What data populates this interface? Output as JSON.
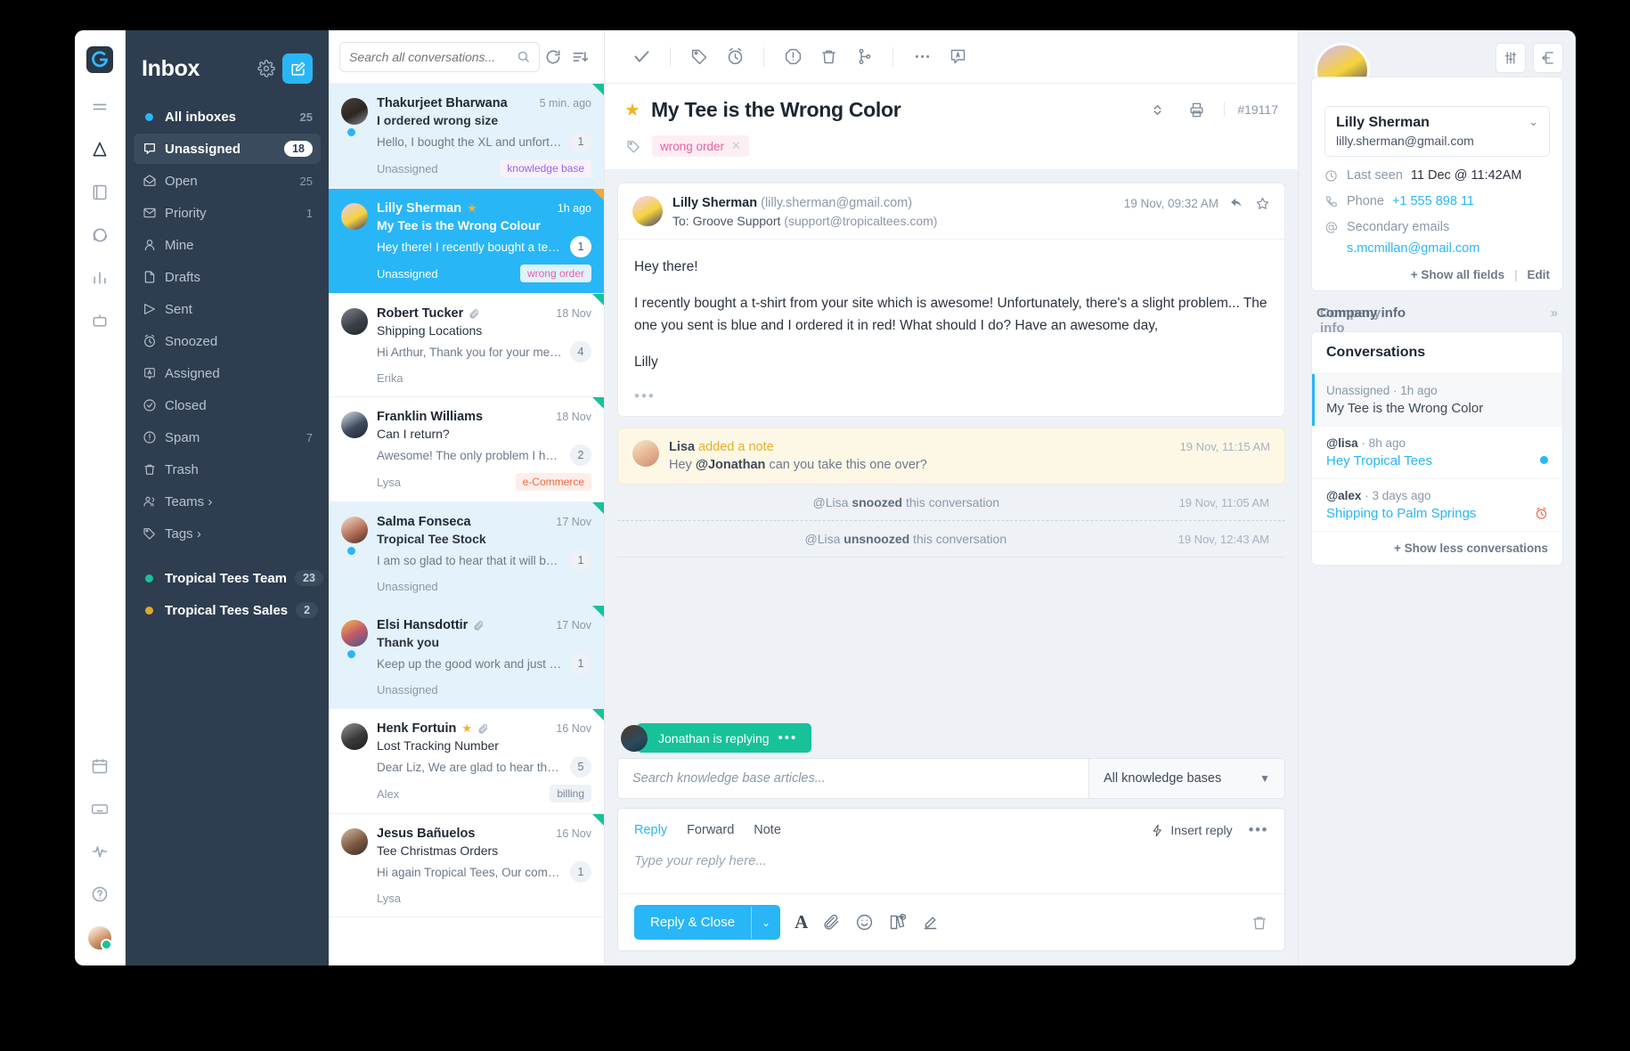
{
  "rail": {
    "logo": "groove-logo",
    "icons": [
      "menu-icon",
      "inbox-icon",
      "contacts-icon",
      "chat-icon",
      "reports-icon",
      "automation-icon",
      "calendar-icon",
      "keyboard-icon",
      "activity-icon",
      "help-icon"
    ]
  },
  "sidebar": {
    "title": "Inbox",
    "gear": "gear-icon",
    "compose": "compose-icon",
    "items": [
      {
        "label": "All inboxes",
        "count": "25",
        "icon": "dot-blue",
        "style": "bold"
      },
      {
        "label": "Unassigned",
        "count": "18",
        "icon": "unassigned-icon",
        "style": "active"
      },
      {
        "label": "Open",
        "count": "25",
        "icon": "open-icon",
        "style": ""
      },
      {
        "label": "Priority",
        "count": "1",
        "icon": "priority-icon",
        "style": ""
      },
      {
        "label": "Mine",
        "count": "",
        "icon": "person-icon",
        "style": ""
      },
      {
        "label": "Drafts",
        "count": "",
        "icon": "draft-icon",
        "style": ""
      },
      {
        "label": "Sent",
        "count": "",
        "icon": "sent-icon",
        "style": ""
      },
      {
        "label": "Snoozed",
        "count": "",
        "icon": "snooze-icon",
        "style": ""
      },
      {
        "label": "Assigned",
        "count": "",
        "icon": "assigned-icon",
        "style": ""
      },
      {
        "label": "Closed",
        "count": "",
        "icon": "closed-icon",
        "style": ""
      },
      {
        "label": "Spam",
        "count": "7",
        "icon": "spam-icon",
        "style": ""
      },
      {
        "label": "Trash",
        "count": "",
        "icon": "trash-icon",
        "style": ""
      },
      {
        "label": "Teams ›",
        "count": "",
        "icon": "teams-icon",
        "style": ""
      },
      {
        "label": "Tags ›",
        "count": "",
        "icon": "tag-icon",
        "style": ""
      }
    ],
    "groups": [
      {
        "label": "Tropical Tees Team",
        "count": "23",
        "dot": "teal"
      },
      {
        "label": "Tropical Tees Sales",
        "count": "2",
        "dot": "amber"
      }
    ]
  },
  "conversation_list": {
    "search_placeholder": "Search all conversations...",
    "search_value": "",
    "refresh_icon": "refresh-icon",
    "sort_icon": "sort-icon",
    "items": [
      {
        "name": "Thakurjeet Bharwana",
        "subject": "I ordered wrong size",
        "preview": "Hello, I bought the XL and unfortuna...",
        "time": "5 min. ago",
        "assignee": "Unassigned",
        "tag": "knowledge base",
        "tag_style": "purple",
        "count": "1",
        "state": "unread",
        "corner": "teal",
        "starred": false,
        "attachment": false,
        "unread_dot": true
      },
      {
        "name": "Lilly Sherman",
        "subject": "My Tee is the Wrong Colour",
        "preview": "Hey there! I recently bought a tee-sh...",
        "time": "1h ago",
        "assignee": "Unassigned",
        "tag": "wrong order",
        "tag_style": "pink",
        "count": "1",
        "state": "selected",
        "corner": "amber",
        "starred": true,
        "attachment": false,
        "unread_dot": false
      },
      {
        "name": "Robert Tucker",
        "subject": "Shipping Locations",
        "preview": "Hi Arthur, Thank you for your messa...",
        "time": "18 Nov",
        "assignee": "Erika",
        "tag": "",
        "tag_style": "",
        "count": "4",
        "state": "",
        "corner": "teal",
        "starred": false,
        "attachment": true,
        "unread_dot": false
      },
      {
        "name": "Franklin Williams",
        "subject": "Can I return?",
        "preview": "Awesome! The only problem I have i...",
        "time": "18 Nov",
        "assignee": "Lysa",
        "tag": "e-Commerce",
        "tag_style": "red",
        "count": "2",
        "state": "",
        "corner": "teal",
        "starred": false,
        "attachment": false,
        "unread_dot": false
      },
      {
        "name": "Salma Fonseca",
        "subject": "Tropical Tee Stock",
        "preview": "I am so glad to hear that it will be ba...",
        "time": "17 Nov",
        "assignee": "Unassigned",
        "tag": "",
        "tag_style": "",
        "count": "1",
        "state": "unread",
        "corner": "teal",
        "starred": false,
        "attachment": false,
        "unread_dot": true
      },
      {
        "name": "Elsi Hansdottir",
        "subject": "Thank you",
        "preview": "Keep up the good work and just let...",
        "time": "17 Nov",
        "assignee": "Unassigned",
        "tag": "",
        "tag_style": "",
        "count": "1",
        "state": "unread",
        "corner": "teal",
        "starred": false,
        "attachment": true,
        "unread_dot": true
      },
      {
        "name": "Henk Fortuin",
        "subject": "Lost Tracking Number",
        "preview": "Dear Liz, We are glad to hear that yo...",
        "time": "16 Nov",
        "assignee": "Alex",
        "tag": "billing",
        "tag_style": "gray",
        "count": "5",
        "state": "",
        "corner": "teal",
        "starred": true,
        "attachment": true,
        "unread_dot": false
      },
      {
        "name": "Jesus Bañuelos",
        "subject": "Tee Christmas Orders",
        "preview": "Hi again Tropical Tees, Our company...",
        "time": "16 Nov",
        "assignee": "Lysa",
        "tag": "",
        "tag_style": "",
        "count": "1",
        "state": "",
        "corner": "teal",
        "starred": false,
        "attachment": false,
        "unread_dot": false
      }
    ]
  },
  "center": {
    "toolbar_icons": [
      "check-icon",
      "tag-icon",
      "snooze-icon",
      "spam-icon",
      "trash-icon",
      "merge-icon",
      "more-icon",
      "assign-icon"
    ],
    "title": "My Tee is the Wrong Color",
    "starred_icon": "star-icon",
    "collapse_icon": "collapse-icon",
    "print_icon": "print-icon",
    "ticket_id": "#19117",
    "tag_icon": "tag-icon",
    "tag_label": "wrong order",
    "tag_close": "close-icon",
    "message": {
      "from_name": "Lilly Sherman",
      "from_email": "(lilly.sherman@gmail.com)",
      "to_label": "To: Groove Support",
      "to_email": "(support@tropicaltees.com)",
      "time": "19 Nov, 09:32 AM",
      "reply_icon": "reply-icon",
      "star_icon": "star-outline-icon",
      "body_p1": "Hey there!",
      "body_p2": "I recently bought a t-shirt from your site which is awesome! Unfortunately, there's a slight problem... The one you sent is blue and I ordered it in red! What should I do? Have an awesome day,",
      "body_p3": "Lilly",
      "expand": "•••"
    },
    "note": {
      "author": "Lisa",
      "action": "added a note",
      "text_pre": "Hey ",
      "mention": "@Jonathan",
      "text_post": " can you take this one over?",
      "time": "19 Nov, 11:15 AM"
    },
    "events": [
      {
        "pre": "@Lisa ",
        "verb": "snoozed",
        "post": " this conversation",
        "time": "19 Nov, 11:05 AM"
      },
      {
        "pre": "@Lisa ",
        "verb": "unsnoozed",
        "post": " this conversation",
        "time": "19 Nov, 12:43 AM"
      }
    ],
    "typing": "Jonathan is replying",
    "typing_dots": "•••",
    "kb_placeholder": "Search knowledge base articles...",
    "kb_select": "All knowledge bases",
    "tabs": [
      {
        "label": "Reply",
        "active": true
      },
      {
        "label": "Forward",
        "active": false
      },
      {
        "label": "Note",
        "active": false
      }
    ],
    "insert_reply": "Insert reply",
    "editor_more": "•••",
    "editor_placeholder": "Type your reply here...",
    "send_button": "Reply & Close",
    "send_caret": "∨",
    "editor_icons": [
      "format-text-icon",
      "attachment-icon",
      "emoji-icon",
      "knowledge-base-icon",
      "signature-icon",
      "discard-icon"
    ]
  },
  "right": {
    "settings_icon": "sliders-icon",
    "expand_icon": "open-panel-icon",
    "avatar": "contact-avatar",
    "contact_name": "Lilly Sherman",
    "contact_email": "lilly.sherman@gmail.com",
    "contact_chevron": "chevron-down-icon",
    "fields": [
      {
        "icon": "clock-icon",
        "label": "Last seen",
        "value": "11 Dec @ 11:42AM",
        "link": false
      },
      {
        "icon": "phone-icon",
        "label": "Phone",
        "value": "+1 555 898 11",
        "link": true
      },
      {
        "icon": "at-icon",
        "label": "Secondary emails",
        "value": "",
        "link": false
      }
    ],
    "secondary_email": "s.mcmillan@gmail.com",
    "show_all_fields": "+ Show all fields",
    "edit": "Edit",
    "company_info": "Company info",
    "company_chevron": "»",
    "conversations_title": "Conversations",
    "conversations": [
      {
        "meta": "Unassigned · 1h ago",
        "meta_bold": "",
        "subject": "My Tee is the Wrong Color",
        "link": false,
        "badge": "",
        "active": true
      },
      {
        "meta_bold": "@lisa",
        "meta": " · 8h ago",
        "subject": "Hey Tropical Tees",
        "link": true,
        "badge": "dot",
        "active": false
      },
      {
        "meta_bold": "@alex",
        "meta": " · 3 days ago",
        "subject": "Shipping to Palm Springs",
        "link": true,
        "badge": "alarm",
        "active": false
      }
    ],
    "show_less": "+ Show less conversations"
  }
}
